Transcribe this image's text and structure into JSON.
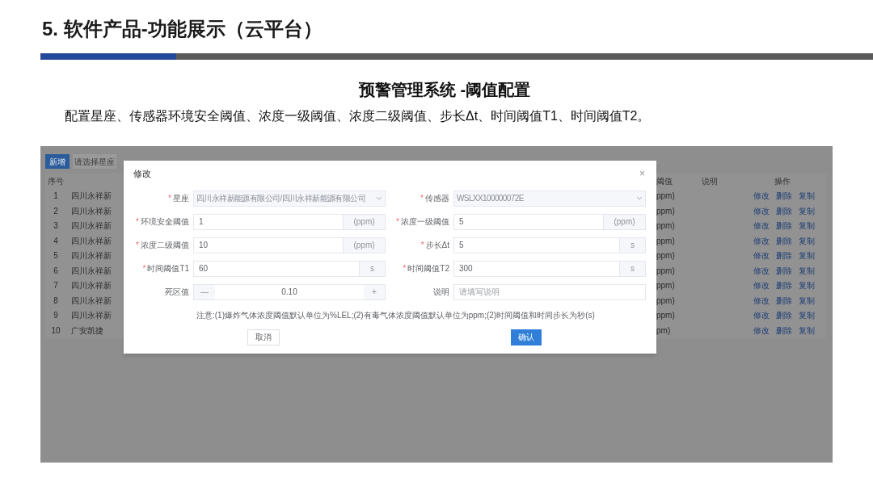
{
  "slide": {
    "title": "5. 软件产品-功能展示（云平台）",
    "heading": "预警管理系统 -阈值配置",
    "description": "配置星座、传感器环境安全阈值、浓度一级阈值、浓度二级阈值、步长Δt、时间阈值T1、时间阈值T2。"
  },
  "screenshot": {
    "toolbar": {
      "add_button": "新增",
      "filter_placeholder": "请选择星座"
    },
    "table": {
      "index_header": "序号",
      "threshold_header": "阈值",
      "note_header": "说明",
      "actions_header": "操作",
      "rows": [
        {
          "index": "1",
          "name": "四川永祥新",
          "threshold": "ppm)",
          "actions": [
            "修改",
            "删除",
            "复制"
          ]
        },
        {
          "index": "2",
          "name": "四川永祥新",
          "threshold": "ppm)",
          "actions": [
            "修改",
            "删除",
            "复制"
          ]
        },
        {
          "index": "3",
          "name": "四川永祥新",
          "threshold": "ppm)",
          "actions": [
            "修改",
            "删除",
            "复制"
          ]
        },
        {
          "index": "4",
          "name": "四川永祥新",
          "threshold": "ppm)",
          "actions": [
            "修改",
            "删除",
            "复制"
          ]
        },
        {
          "index": "5",
          "name": "四川永祥新",
          "threshold": "ppm)",
          "actions": [
            "修改",
            "删除",
            "复制"
          ]
        },
        {
          "index": "6",
          "name": "四川永祥新",
          "threshold": "ppm)",
          "actions": [
            "修改",
            "删除",
            "复制"
          ]
        },
        {
          "index": "7",
          "name": "四川永祥新",
          "threshold": "ppm)",
          "actions": [
            "修改",
            "删除",
            "复制"
          ]
        },
        {
          "index": "8",
          "name": "四川永祥新",
          "threshold": "ppm)",
          "actions": [
            "修改",
            "删除",
            "复制"
          ]
        },
        {
          "index": "9",
          "name": "四川永祥新",
          "threshold": "ppm)",
          "actions": [
            "修改",
            "删除",
            "复制"
          ]
        },
        {
          "index": "10",
          "name": "广安凯捷",
          "threshold": "pm)",
          "actions": [
            "修改",
            "删除",
            "复制"
          ]
        }
      ]
    },
    "dialog": {
      "title": "修改",
      "close": "×",
      "required_mark": "*",
      "rows": [
        [
          {
            "kind": "select",
            "label": "星座",
            "required": true,
            "value": "四川永祥新能源有限公司/四川永祥新能源有限公司",
            "disabled": true
          },
          {
            "kind": "select",
            "label": "传感器",
            "required": true,
            "value": "WSLXX100000072E",
            "disabled": true
          }
        ],
        [
          {
            "kind": "unit",
            "label": "环境安全阈值",
            "required": true,
            "value": "1",
            "unit": "(ppm)"
          },
          {
            "kind": "unit",
            "label": "浓度一级阈值",
            "required": true,
            "value": "5",
            "unit": "(ppm)"
          }
        ],
        [
          {
            "kind": "unit",
            "label": "浓度二级阈值",
            "required": true,
            "value": "10",
            "unit": "(ppm)"
          },
          {
            "kind": "unit",
            "label": "步长Δt",
            "required": true,
            "value": "5",
            "unit": "s"
          }
        ],
        [
          {
            "kind": "unit",
            "label": "时间阈值T1",
            "required": true,
            "value": "60",
            "unit": "s"
          },
          {
            "kind": "unit",
            "label": "时间阈值T2",
            "required": true,
            "value": "300",
            "unit": "s"
          }
        ],
        [
          {
            "kind": "stepper",
            "label": "死区值",
            "required": false,
            "value": "0.10",
            "minus": "—",
            "plus": "+"
          },
          {
            "kind": "text",
            "label": "说明",
            "required": false,
            "placeholder": "请填写说明"
          }
        ]
      ],
      "note": "注意:(1)爆炸气体浓度阈值默认单位为%LEL;(2)有毒气体浓度阈值默认单位为ppm;(2)时间阈值和时间步长为秒(s)",
      "cancel": "取消",
      "confirm": "确认"
    }
  }
}
